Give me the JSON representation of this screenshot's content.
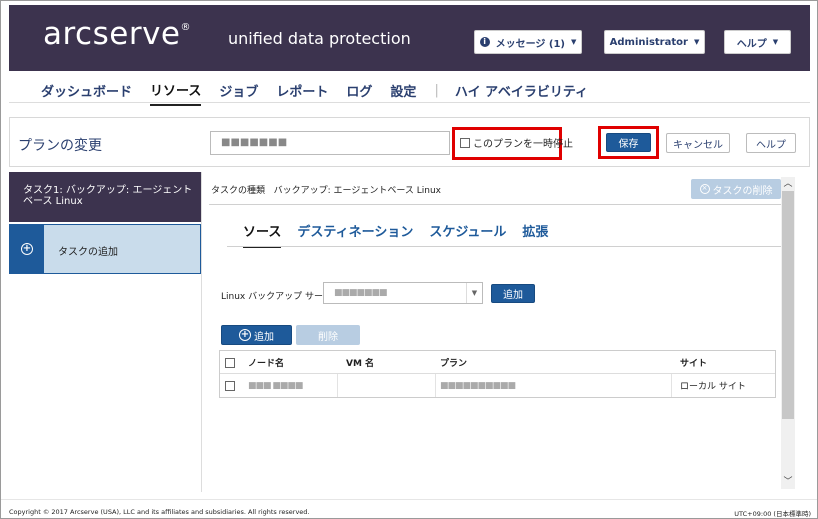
{
  "header": {
    "logo": "arcserve",
    "logo_mark": "®",
    "subtitle": "unified data protection",
    "messages_label": "メッセージ (1)",
    "user_label": "Administrator",
    "help_label": "ヘルプ"
  },
  "nav": {
    "items": [
      "ダッシュボード",
      "リソース",
      "ジョブ",
      "レポート",
      "ログ",
      "設定"
    ],
    "separator": "|",
    "extra": "ハイ アベイラビリティ",
    "active": "リソース"
  },
  "plan": {
    "title": "プランの変更",
    "name_value": "■■■■■■■",
    "pause_label": "このプランを一時停止",
    "pause_checked": false,
    "save_label": "保存",
    "cancel_label": "キャンセル",
    "help_label": "ヘルプ"
  },
  "tasks": {
    "task1_line1": "タスク1: バックアップ: エージェント",
    "task1_line2": "ベース Linux",
    "add_task_label": "タスクの追加"
  },
  "task_detail": {
    "type_label": "タスクの種類",
    "type_value": "バックアップ: エージェントベース Linux",
    "delete_task_label": "タスクの削除",
    "tabs": [
      "ソース",
      "デスティネーション",
      "スケジュール",
      "拡張"
    ],
    "active_tab": "ソース"
  },
  "source": {
    "server_label": "Linux バックアップ サーバ",
    "server_value": "■■■■■■■",
    "server_add_label": "追加",
    "add_node_label": "追加",
    "remove_label": "削除",
    "table": {
      "columns": [
        "ノード名",
        "VM 名",
        "プラン",
        "サイト"
      ],
      "rows": [
        {
          "node": "■■■ ■■■■",
          "vm": "",
          "plan": "■■■■■■■■■■",
          "site": "ローカル サイト"
        }
      ]
    }
  },
  "footer": {
    "copyright": "Copyright © 2017 Arcserve (USA), LLC and its affiliates and subsidiaries. All rights reserved.",
    "timezone": "UTC+09:00 (日本標準時)"
  },
  "colors": {
    "header_bg": "#3c334e",
    "primary": "#1e5a9a",
    "highlight_box": "#e00000",
    "disabled_button": "#b8cde2"
  },
  "icons": [
    "info-icon",
    "chevron-down-icon",
    "plus-circle-icon",
    "close-circle-icon",
    "checkbox-icon",
    "scroll-up-icon",
    "scroll-down-icon"
  ]
}
